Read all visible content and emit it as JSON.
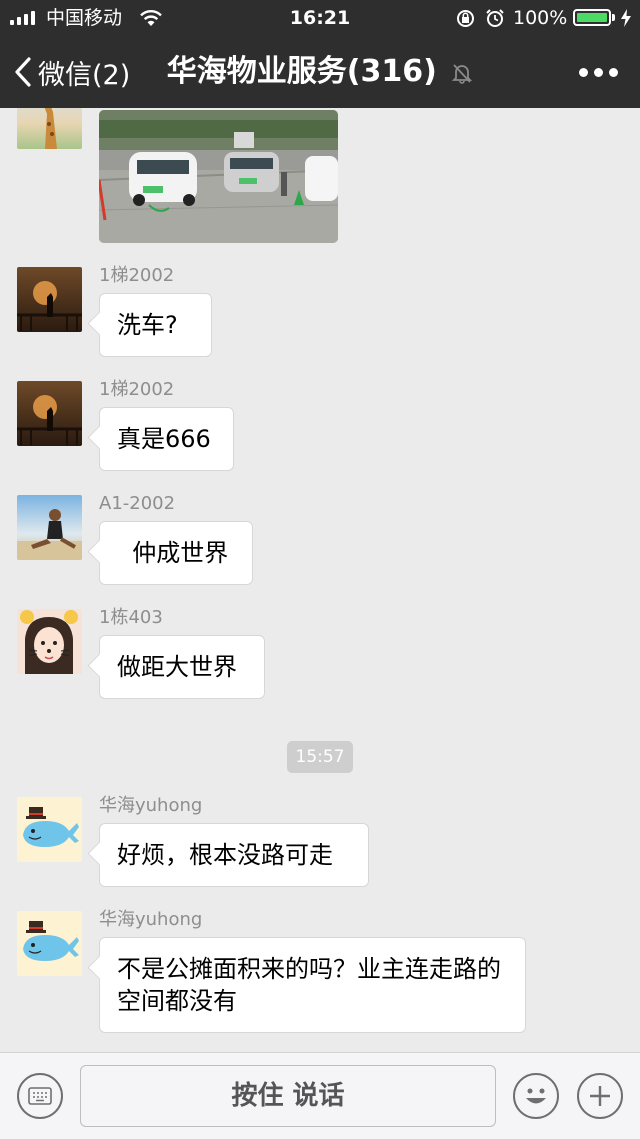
{
  "status_bar": {
    "carrier": "中国移动",
    "time": "16:21",
    "battery": "100%"
  },
  "nav": {
    "back_label": "微信(2)",
    "title": "华海物业服务(316)",
    "more_icon": "more-dots-icon",
    "mute_icon": "mute-bell-icon"
  },
  "messages": [
    {
      "nick": "1梯2002",
      "text": "洗车?"
    },
    {
      "nick": "1梯2002",
      "text": "真是666"
    },
    {
      "nick": "A1-2002",
      "text": "  仲成世界"
    },
    {
      "nick": "1栋403",
      "text": "做距大世界"
    },
    {
      "nick": "华海yuhong",
      "text": "好烦，根本没路可走"
    },
    {
      "nick": "华海yuhong",
      "text": "不是公摊面积来的吗？业主连走路的空间都没有"
    }
  ],
  "timestamp": "15:57",
  "input_bar": {
    "hold_to_talk": "按住 说话",
    "keyboard_icon": "keyboard-icon",
    "emoji_icon": "emoji-icon",
    "plus_icon": "plus-icon"
  },
  "colors": {
    "nav_bg": "#2e2e2e",
    "chat_bg": "#ebebeb",
    "battery_green": "#4cd964"
  }
}
